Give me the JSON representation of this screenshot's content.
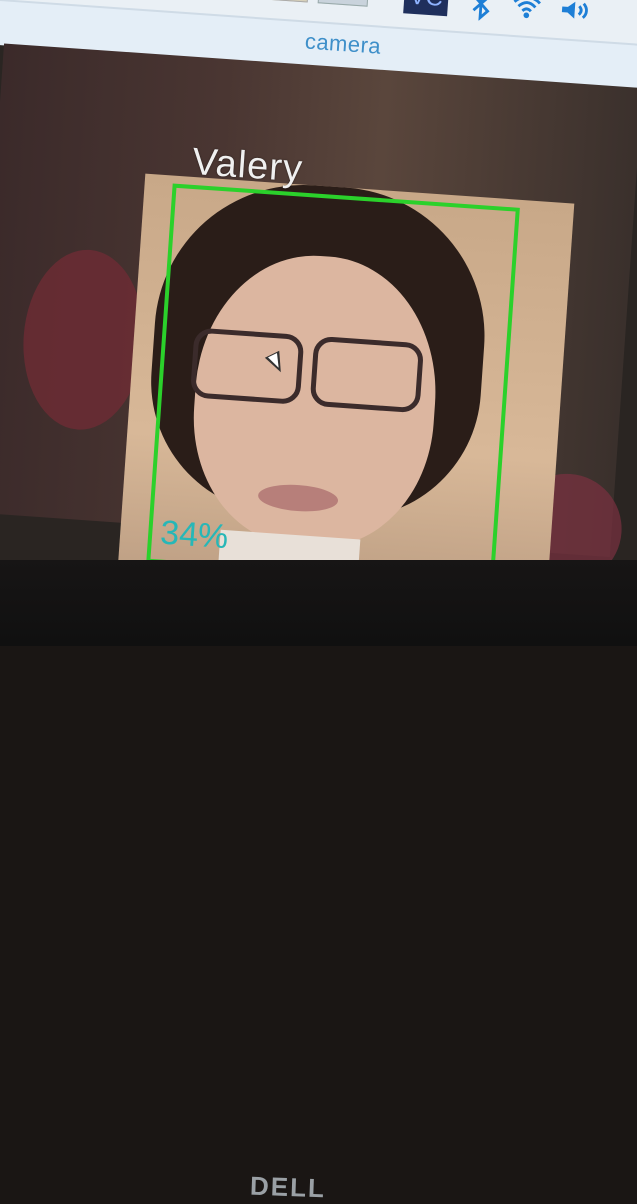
{
  "window": {
    "title": "camera"
  },
  "tray": {
    "vc_label": "VC"
  },
  "detection": {
    "name": "Valery",
    "confidence": "34%"
  },
  "monitor": {
    "brand": "DELL"
  },
  "colors": {
    "box": "#2bd12b",
    "confidence": "#27b7b7",
    "title": "#3e8fc9"
  }
}
